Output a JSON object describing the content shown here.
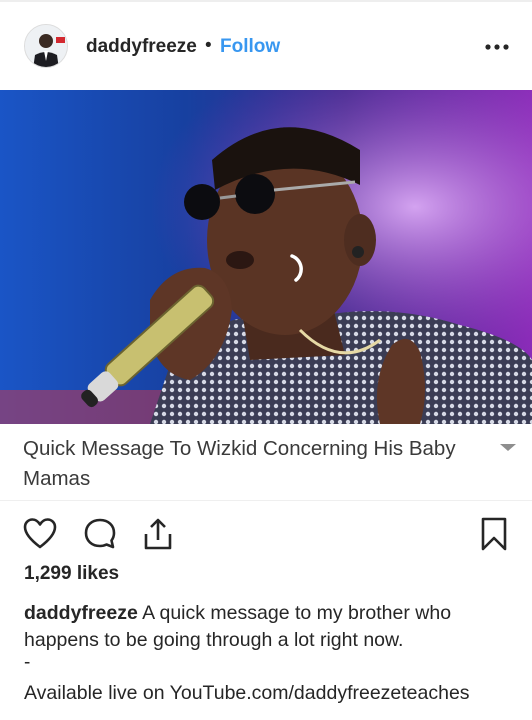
{
  "post": {
    "username": "daddyfreeze",
    "separator": "•",
    "follow_label": "Follow",
    "more_icon": "more-horizontal-icon",
    "avatar_badge": "DFGA",
    "media_description_icon": "photo-of-performer"
  },
  "caption": {
    "title": "Quick Message To Wizkid Concerning His Baby Mamas",
    "expand_icon": "chevron-down-icon"
  },
  "actions": {
    "like_icon": "heart-icon",
    "comment_icon": "comment-icon",
    "share_icon": "share-icon",
    "save_icon": "bookmark-icon"
  },
  "likes": "1,299 likes",
  "description": {
    "username": "daddyfreeze",
    "text": "A quick message to my brother who happens to be going through a lot right now.",
    "separator": "-",
    "live_text": "Available live on YouTube.com/daddyfreezeteaches"
  },
  "colors": {
    "link_blue": "#3897f0",
    "text": "#262626",
    "stage_blue": "#1c4fb8",
    "stage_purple": "#7b2ab5"
  }
}
